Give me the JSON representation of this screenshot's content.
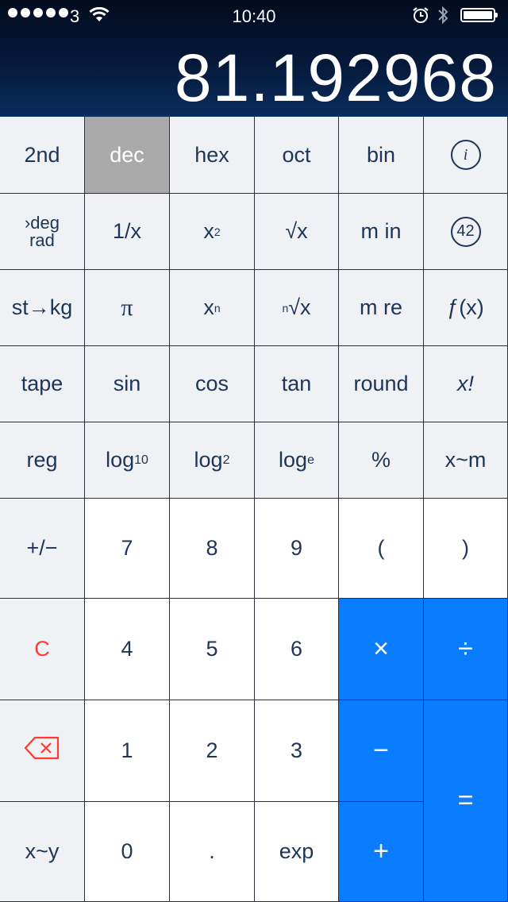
{
  "status": {
    "carrier": "3",
    "time": "10:40"
  },
  "display": {
    "value": "81.192968"
  },
  "keys": {
    "second": "2nd",
    "dec": "dec",
    "hex": "hex",
    "oct": "oct",
    "bin": "bin",
    "info": "i",
    "deg_top": "›deg",
    "deg_bottom": "rad",
    "reciprocal": "1/x",
    "square_base": "x",
    "square_exp": "2",
    "sqrt": "√x",
    "m_in": "m in",
    "badge": "42",
    "st_kg": "st→kg",
    "pi": "π",
    "power_base": "x",
    "power_exp": "n",
    "nroot_idx": "n",
    "nroot": "√x",
    "m_re": "m re",
    "fx": "ƒ(x)",
    "tape": "tape",
    "sin": "sin",
    "cos": "cos",
    "tan": "tan",
    "round": "round",
    "factorial": "x!",
    "reg": "reg",
    "log_base": "log",
    "log10_sub": "10",
    "log2_sub": "2",
    "loge_sub": "e",
    "percent": "%",
    "x_m": "x~m",
    "plus_minus": "+/−",
    "seven": "7",
    "eight": "8",
    "nine": "9",
    "lparen": "(",
    "rparen": ")",
    "clear": "C",
    "four": "4",
    "five": "5",
    "six": "6",
    "multiply": "×",
    "divide": "÷",
    "one": "1",
    "two": "2",
    "three": "3",
    "minus": "−",
    "equals": "=",
    "x_y": "x~y",
    "zero": "0",
    "point": ".",
    "exp": "exp",
    "plus": "+"
  },
  "colors": {
    "accent": "#0a7cff",
    "header_bg": "#05193a",
    "text": "#1d3557",
    "clear": "#ff3b30",
    "selected": "#aaaaaa"
  }
}
